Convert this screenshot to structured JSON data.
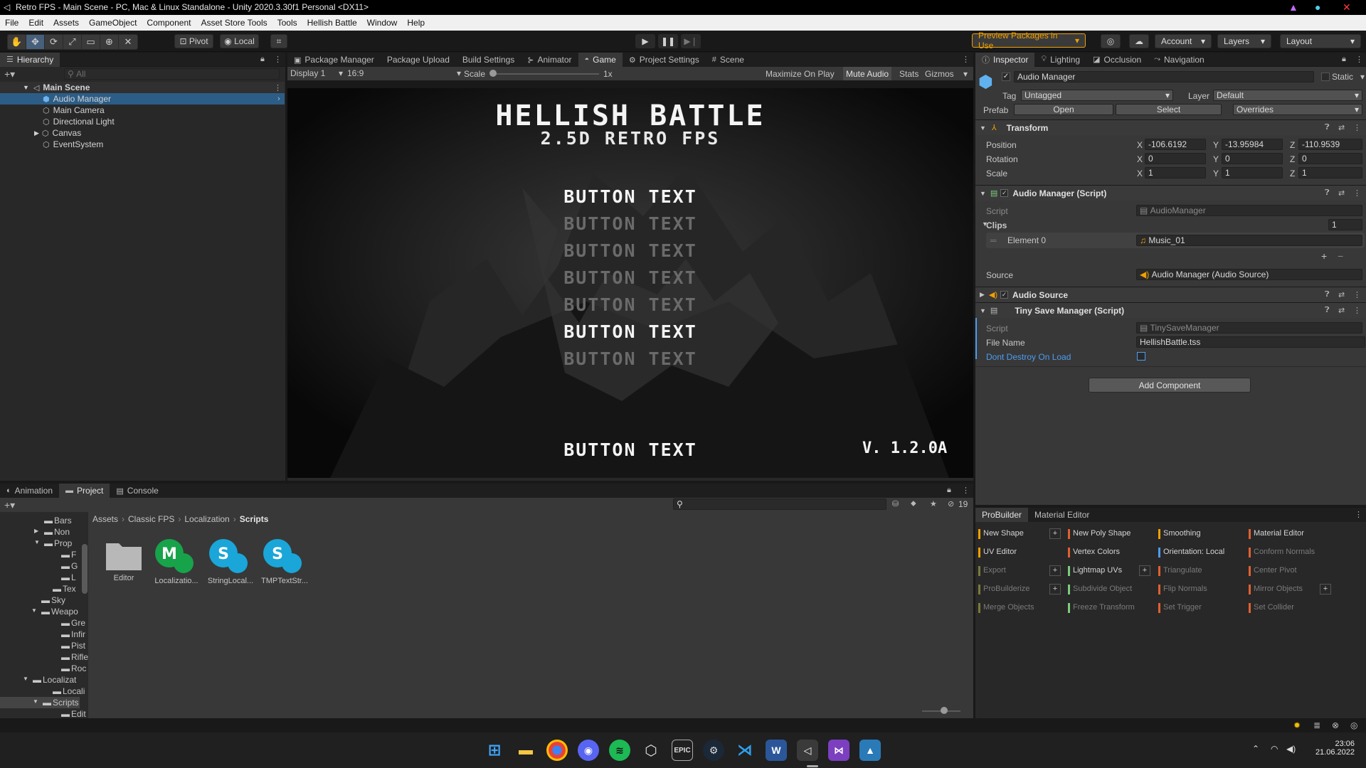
{
  "window": {
    "title": "Retro FPS - Main Scene - PC, Mac & Linux Standalone - Unity 2020.3.30f1 Personal <DX11>"
  },
  "menu": [
    "File",
    "Edit",
    "Assets",
    "GameObject",
    "Component",
    "Asset Store Tools",
    "Tools",
    "Hellish Battle",
    "Window",
    "Help"
  ],
  "toolbar": {
    "pivot": "Pivot",
    "local": "Local",
    "preview_packages": "Preview Packages in Use",
    "account": "Account",
    "layers": "Layers",
    "layout": "Layout"
  },
  "hierarchy": {
    "tab": "Hierarchy",
    "search_placeholder": "All",
    "scene": "Main Scene",
    "items": [
      "Audio Manager",
      "Main Camera",
      "Directional Light",
      "Canvas",
      "EventSystem"
    ]
  },
  "center_tabs": [
    "Package Manager",
    "Package Upload",
    "Build Settings",
    "Animator",
    "Game",
    "Project Settings",
    "Scene"
  ],
  "game_controls": {
    "display": "Display 1",
    "aspect": "16:9",
    "scale_label": "Scale",
    "scale_value": "1x",
    "maximize": "Maximize On Play",
    "mute": "Mute Audio",
    "stats": "Stats",
    "gizmos": "Gizmos"
  },
  "game": {
    "title": "HELLISH BATTLE",
    "subtitle": "2.5D RETRO FPS",
    "buttons": [
      "BUTTON TEXT",
      "BUTTON TEXT",
      "BUTTON TEXT",
      "BUTTON TEXT",
      "BUTTON TEXT",
      "BUTTON TEXT",
      "BUTTON TEXT"
    ],
    "bottom_button": "BUTTON TEXT",
    "version": "V. 1.2.0A"
  },
  "inspector": {
    "tabs": [
      "Inspector",
      "Lighting",
      "Occlusion",
      "Navigation"
    ],
    "object_name": "Audio Manager",
    "static": "Static",
    "tag_label": "Tag",
    "tag_value": "Untagged",
    "layer_label": "Layer",
    "layer_value": "Default",
    "prefab_label": "Prefab",
    "open": "Open",
    "select": "Select",
    "overrides": "Overrides",
    "transform": {
      "title": "Transform",
      "position_label": "Position",
      "rotation_label": "Rotation",
      "scale_label": "Scale",
      "position": [
        "-106.6192",
        "-13.95984",
        "-110.9539"
      ],
      "rotation": [
        "0",
        "0",
        "0"
      ],
      "scale": [
        "1",
        "1",
        "1"
      ]
    },
    "audio_manager": {
      "title": "Audio Manager (Script)",
      "script_label": "Script",
      "script_value": "AudioManager",
      "clips_label": "Clips",
      "clips_count": "1",
      "element_label": "Element 0",
      "element_value": "Music_01",
      "source_label": "Source",
      "source_value": "Audio Manager (Audio Source)"
    },
    "audio_source": {
      "title": "Audio Source"
    },
    "tiny_save": {
      "title": "Tiny Save Manager (Script)",
      "script_label": "Script",
      "script_value": "TinySaveManager",
      "file_label": "File Name",
      "file_value": "HellishBattle.tss",
      "dont_destroy_label": "Dont Destroy On Load"
    },
    "add_component": "Add Component"
  },
  "bottom_tabs": [
    "Animation",
    "Project",
    "Console"
  ],
  "project": {
    "hidden_count": "19",
    "breadcrumb": [
      "Assets",
      "Classic FPS",
      "Localization",
      "Scripts"
    ],
    "tree": [
      "Bars",
      "Non",
      "Prop",
      "F",
      "G",
      "L",
      "Tex",
      "Sky",
      "Weapo",
      "Gre",
      "Infir",
      "Pist",
      "Rifle",
      "Roc",
      "Localizat",
      "Locali",
      "Scripts",
      "Edit"
    ],
    "assets": [
      "Editor",
      "Localizatio...",
      "StringLocal...",
      "TMPTextStr..."
    ]
  },
  "probuilder": {
    "tabs": [
      "ProBuilder",
      "Material Editor"
    ],
    "buttons": [
      [
        "New Shape",
        "New Poly Shape",
        "Smoothing",
        "Material Editor"
      ],
      [
        "UV Editor",
        "Vertex Colors",
        "Orientation: Local",
        "Conform Normals"
      ],
      [
        "Export",
        "Lightmap UVs",
        "Triangulate",
        "Center Pivot"
      ],
      [
        "ProBuilderize",
        "Subdivide Object",
        "Flip Normals",
        "Mirror Objects"
      ],
      [
        "Merge Objects",
        "Freeze Transform",
        "Set Trigger",
        "Set Collider"
      ]
    ]
  },
  "clock": {
    "time": "23:06",
    "date": "21.06.2022"
  },
  "colors": {
    "selection": "#2c5d87",
    "accent_orange": "#f0a000",
    "link_blue": "#4d9cf0"
  }
}
